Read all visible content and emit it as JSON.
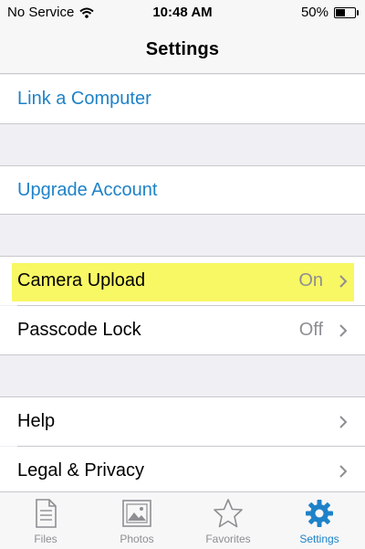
{
  "status_bar": {
    "carrier": "No Service",
    "time": "10:48 AM",
    "battery_percent": "50%",
    "battery_level": 0.5
  },
  "nav": {
    "title": "Settings"
  },
  "sections": [
    {
      "items": [
        {
          "label": "Link a Computer"
        }
      ]
    },
    {
      "items": [
        {
          "label": "Upgrade Account"
        }
      ]
    },
    {
      "items": [
        {
          "label": "Camera Upload",
          "value": "On"
        },
        {
          "label": "Passcode Lock",
          "value": "Off"
        }
      ]
    },
    {
      "items": [
        {
          "label": "Help"
        },
        {
          "label": "Legal & Privacy"
        }
      ]
    }
  ],
  "tabs": [
    {
      "label": "Files",
      "icon": "files-icon"
    },
    {
      "label": "Photos",
      "icon": "photos-icon"
    },
    {
      "label": "Favorites",
      "icon": "favorites-icon"
    },
    {
      "label": "Settings",
      "icon": "settings-gear-icon",
      "active": true
    }
  ],
  "colors": {
    "accent": "#1e82c8",
    "highlight": "#f8f764",
    "secondary_text": "#8e8e93",
    "group_background": "#efeff4"
  }
}
